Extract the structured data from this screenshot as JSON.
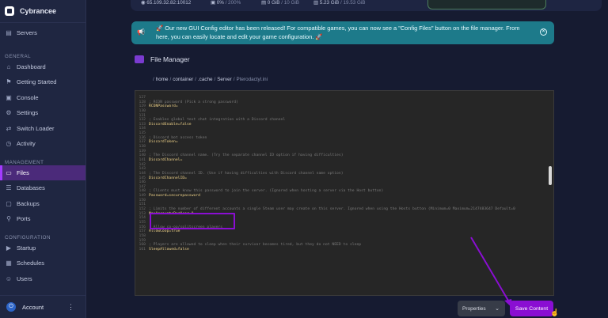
{
  "brand": {
    "name": "Cybrancee"
  },
  "sidebar": {
    "top_items": [
      {
        "label": "Servers",
        "icon": "server-icon"
      }
    ],
    "general_label": "GENERAL",
    "general_items": [
      {
        "label": "Dashboard",
        "icon": "dashboard-icon"
      },
      {
        "label": "Getting Started",
        "icon": "rocket-icon"
      },
      {
        "label": "Console",
        "icon": "terminal-icon"
      },
      {
        "label": "Settings",
        "icon": "gear-icon"
      },
      {
        "label": "Switch Loader",
        "icon": "switch-icon"
      },
      {
        "label": "Activity",
        "icon": "activity-icon"
      }
    ],
    "management_label": "MANAGEMENT",
    "management_items": [
      {
        "label": "Files",
        "icon": "folder-icon",
        "active": true
      },
      {
        "label": "Databases",
        "icon": "database-icon"
      },
      {
        "label": "Backups",
        "icon": "backup-icon"
      },
      {
        "label": "Ports",
        "icon": "ports-icon"
      }
    ],
    "configuration_label": "CONFIGURATION",
    "configuration_items": [
      {
        "label": "Startup",
        "icon": "startup-icon"
      },
      {
        "label": "Schedules",
        "icon": "calendar-icon"
      },
      {
        "label": "Users",
        "icon": "users-icon"
      }
    ],
    "account_label": "Account"
  },
  "stats": {
    "ip": "65.109.32.82:10012",
    "cpu": "0%",
    "cpu_max": "/ 200%",
    "disk": "0 GiB",
    "disk_max": "/ 10 GiB",
    "memory": "5.23 GiB",
    "memory_max": "/ 19.53 GiB"
  },
  "banner": {
    "text": "🚀 Our new GUI Config editor has been released! For compatible games, you can now see a \"Config Files\" button on the file manager. From here, you can easily locate and edit your game configuration. 🚀"
  },
  "file_manager": {
    "title": "File Manager",
    "breadcrumb": [
      "home",
      "container",
      ".cache",
      "Server",
      "Pterodactyl.ini"
    ]
  },
  "editor": {
    "lines": [
      {
        "n": "127",
        "t": "",
        "c": "comment"
      },
      {
        "n": "128",
        "t": "; RCON password (Pick a strong password)",
        "c": "comment"
      },
      {
        "n": "129",
        "t": "RCONPassword=",
        "c": "kv"
      },
      {
        "n": "130",
        "t": "",
        "c": "comment"
      },
      {
        "n": "131",
        "t": "",
        "c": "comment"
      },
      {
        "n": "132",
        "t": "; Enables global text chat integration with a Discord channel",
        "c": "comment"
      },
      {
        "n": "133",
        "t": "DiscordEnable=false",
        "c": "kv"
      },
      {
        "n": "134",
        "t": "",
        "c": "comment"
      },
      {
        "n": "135",
        "t": "",
        "c": "comment"
      },
      {
        "n": "136",
        "t": "; Discord bot access token",
        "c": "comment"
      },
      {
        "n": "137",
        "t": "DiscordToken=",
        "c": "kv"
      },
      {
        "n": "138",
        "t": "",
        "c": "comment"
      },
      {
        "n": "139",
        "t": "",
        "c": "comment"
      },
      {
        "n": "140",
        "t": "; The Discord channel name. (Try the separate channel ID option if having difficulties)",
        "c": "comment"
      },
      {
        "n": "141",
        "t": "DiscordChannel=",
        "c": "kv"
      },
      {
        "n": "142",
        "t": "",
        "c": "comment"
      },
      {
        "n": "143",
        "t": "",
        "c": "comment"
      },
      {
        "n": "144",
        "t": "; The Discord channel ID. (Use if having difficulties with Discord channel name option)",
        "c": "comment"
      },
      {
        "n": "145",
        "t": "DiscordChannelID=",
        "c": "kv"
      },
      {
        "n": "146",
        "t": "",
        "c": "comment"
      },
      {
        "n": "147",
        "t": "",
        "c": "comment"
      },
      {
        "n": "148",
        "t": "; Clients must know this password to join the server. (Ignored when hosting a server via the Host button)",
        "c": "comment"
      },
      {
        "n": "149",
        "t": "Password=securepassword",
        "c": "kv"
      },
      {
        "n": "150",
        "t": "",
        "c": "comment"
      },
      {
        "n": "151",
        "t": "",
        "c": "comment"
      },
      {
        "n": "152",
        "t": "; Limits the number of different accounts a single Steam user may create on this server. Ignored when using the Hosts button (Minimum=0 Maximum=2147483647 Default=0",
        "c": "comment"
      },
      {
        "n": "153",
        "t": "MaxAccountsPerUser=0",
        "c": "kv"
      },
      {
        "n": "154",
        "t": "",
        "c": "comment"
      },
      {
        "n": "155",
        "t": "",
        "c": "comment"
      },
      {
        "n": "156",
        "t": "; Allow co-op/splitscreen players",
        "c": "comment"
      },
      {
        "n": "157",
        "t": "AllowCoop=true",
        "c": "kv"
      },
      {
        "n": "158",
        "t": "",
        "c": "comment"
      },
      {
        "n": "159",
        "t": "",
        "c": "comment"
      },
      {
        "n": "160",
        "t": "; Players are allowed to sleep when their survivor becomes tired, but they do not NEED to sleep",
        "c": "comment"
      },
      {
        "n": "161",
        "t": "SleepAllowed=false",
        "c": "kv"
      }
    ]
  },
  "footer": {
    "properties_label": "Properties",
    "save_label": "Save Content"
  },
  "colors": {
    "accent": "#8a0ed2",
    "banner": "#1d7a8a",
    "sidebar": "#1f2641",
    "background": "#161b31"
  }
}
